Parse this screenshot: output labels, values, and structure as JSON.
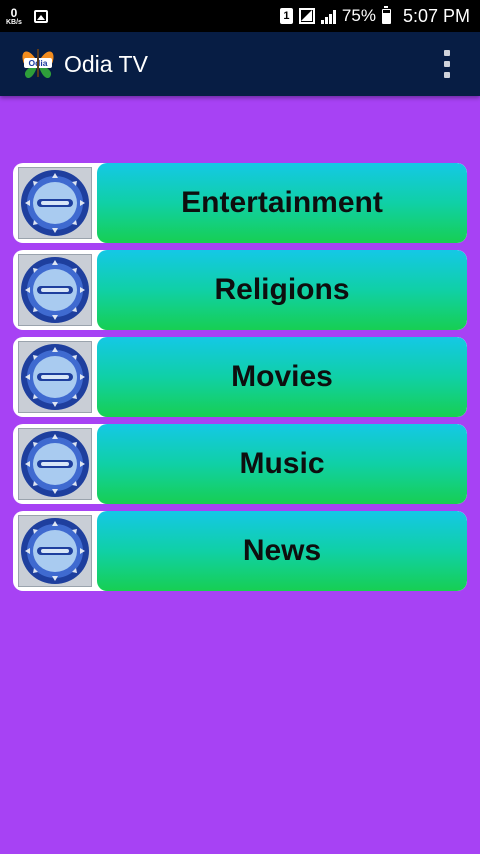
{
  "status_bar": {
    "net_speed_value": "0",
    "net_speed_unit": "KB/s",
    "sim_slot": "1",
    "battery_percent": "75%",
    "time": "5:07 PM"
  },
  "app_bar": {
    "logo_text": "Odia",
    "title": "Odia TV"
  },
  "categories": [
    {
      "label": "Entertainment",
      "icon": "tv-channel-icon"
    },
    {
      "label": "Religions",
      "icon": "tv-channel-icon"
    },
    {
      "label": "Movies",
      "icon": "tv-channel-icon"
    },
    {
      "label": "Music",
      "icon": "tv-channel-icon"
    },
    {
      "label": "News",
      "icon": "tv-channel-icon"
    }
  ],
  "colors": {
    "background": "#a742f4",
    "app_bar": "#071d44",
    "button_gradient_top": "#14c8e6",
    "button_gradient_bottom": "#17cf52"
  }
}
